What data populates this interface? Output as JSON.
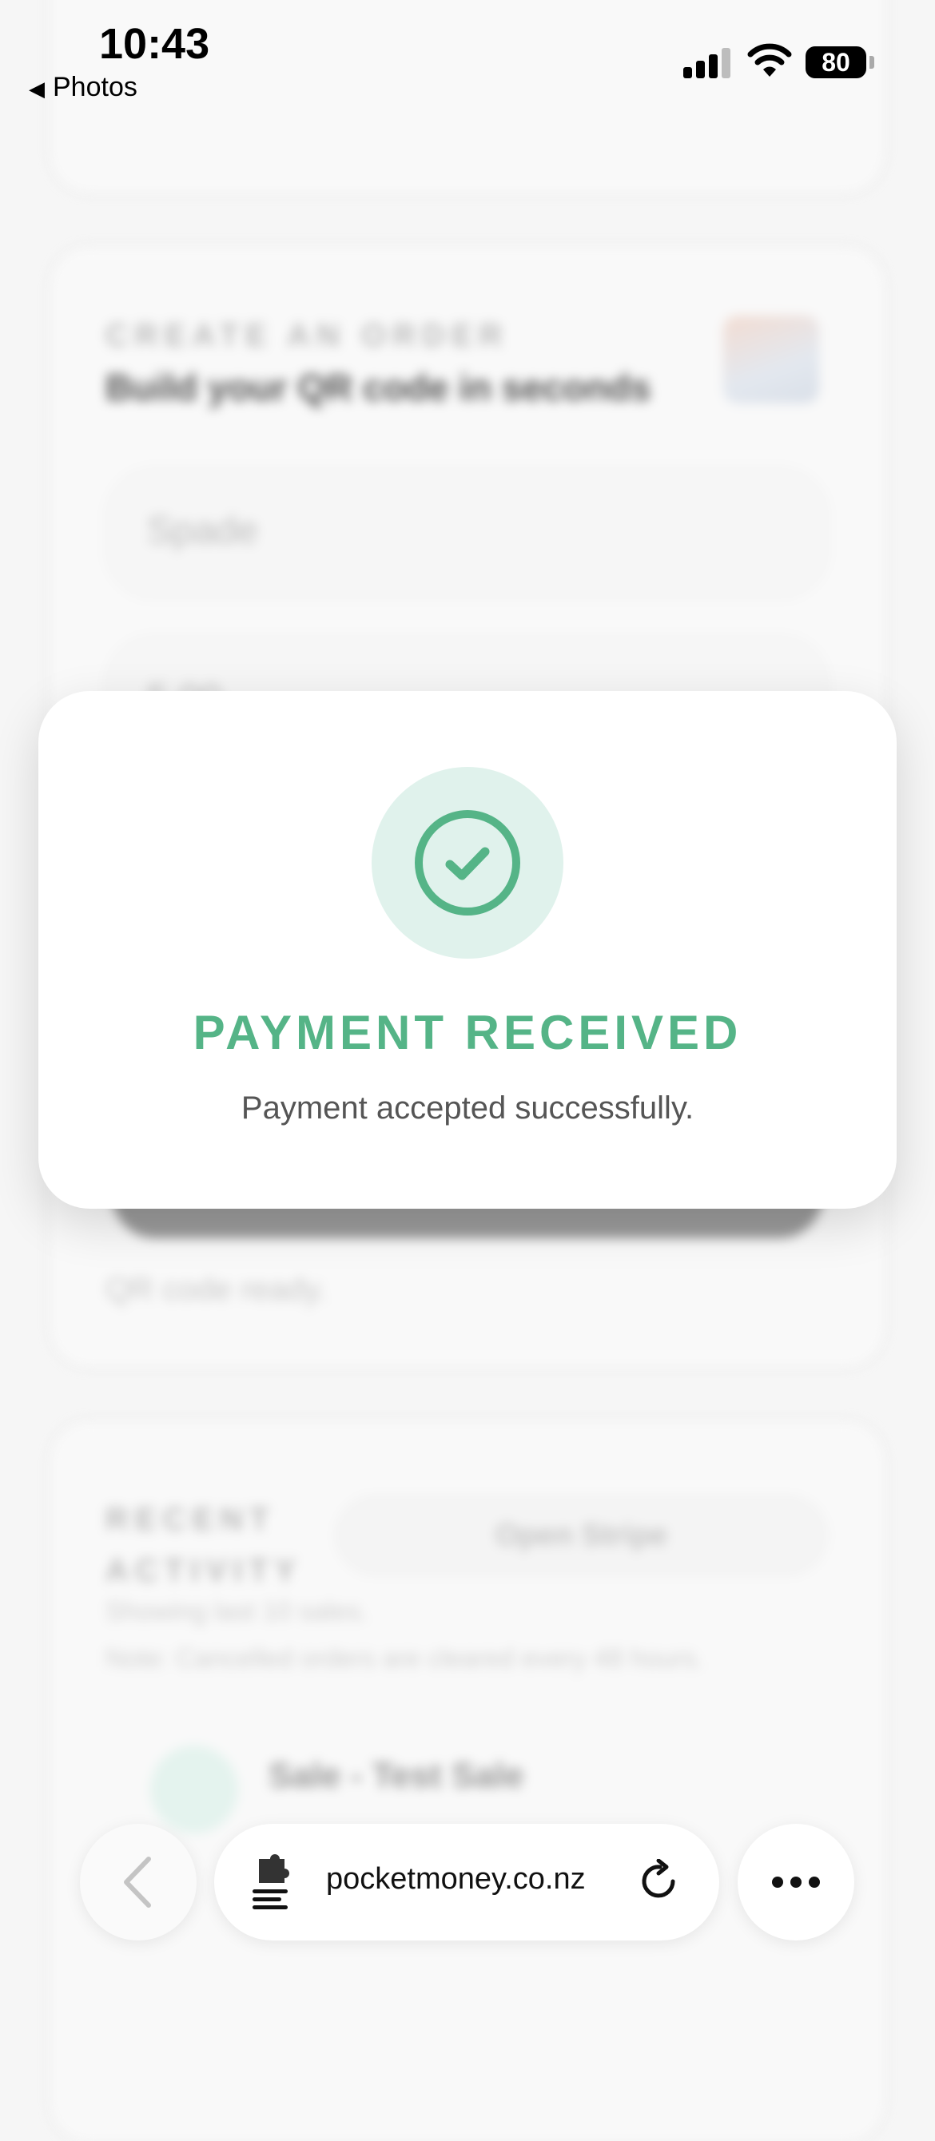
{
  "status_bar": {
    "time": "10:43",
    "back_label": "Photos",
    "battery": "80"
  },
  "background": {
    "order": {
      "eyebrow": "CREATE AN ORDER",
      "title": "Build your QR code in seconds",
      "name_field": "Spade",
      "amount_field": "5.00",
      "status": "QR code ready."
    },
    "activity": {
      "eyebrow_line1": "RECENT",
      "eyebrow_line2": "ACTIVITY",
      "open_stripe_label": "Open Stripe",
      "sub1": "Showing last 10 sales.",
      "sub2": "Note: Cancelled orders are cleared every 48 hours.",
      "sale_title": "Sale - Test Sale"
    }
  },
  "modal": {
    "title": "PAYMENT RECEIVED",
    "message": "Payment accepted successfully.",
    "accent_color": "#55b487",
    "icon": "check-circle-icon"
  },
  "toolbar": {
    "url": "pocketmoney.co.nz"
  }
}
